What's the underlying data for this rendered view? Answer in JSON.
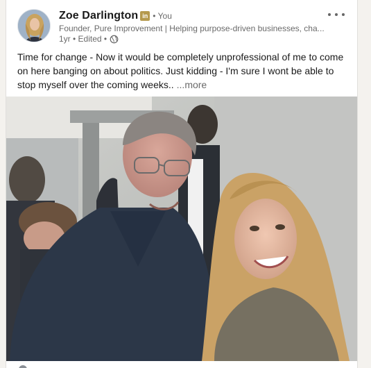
{
  "post": {
    "author": {
      "name": "Zoe Darlington",
      "badge_text": "in",
      "you_label": "• You",
      "headline": "Founder, Pure Improvement | Helping purpose-driven businesses, cha...",
      "meta": "1yr • Edited •",
      "visibility_icon": "globe-icon"
    },
    "text": "Time for change - Now it would be completely unprofessional of me to come on here banging on about politics. Just kidding - I'm sure I wont be able to stop myself over the coming weeks..",
    "see_more": "...more",
    "menu_icon": "more-horizontal-icon",
    "image_icon": "post-photo"
  },
  "colors": {
    "primary_text": "#191919",
    "secondary_text": "#666666",
    "badge": "#b59a4e",
    "card_bg": "#ffffff",
    "page_bg": "#f4f2ee"
  }
}
